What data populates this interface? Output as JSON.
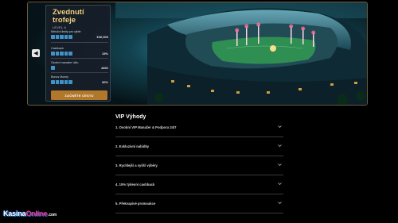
{
  "panel": {
    "title_line1": "Zvednutí",
    "title_line2": "trofeje",
    "level": "LEVEL 6",
    "stats": [
      {
        "label": "Měsíční limity pro výběr",
        "value": "€40,000",
        "filled": 5
      },
      {
        "label": "Cashback",
        "value": "15%",
        "filled": 5
      },
      {
        "label": "Osobní manažer účtu",
        "value": "ANO",
        "filled": 1
      },
      {
        "label": "Bonus Money",
        "value": "30%",
        "filled": 5
      }
    ],
    "cta_label": "ZAČNĚTE CESTU"
  },
  "vip": {
    "title": "VIP Výhody",
    "items": [
      {
        "label": "1. Osobní VIP Manažer & Podpora 24/7"
      },
      {
        "label": "2. Exkluzivní nabídky"
      },
      {
        "label": "3. Rychlejší a vyšší výběry"
      },
      {
        "label": "4. 15% týdenní cashback"
      },
      {
        "label": "5. Překvapivé promoakce"
      }
    ]
  },
  "logo": {
    "part1": "Kasina",
    "part2": "Online",
    "suffix": ".com"
  },
  "colors": {
    "gold": "#f2cf7a",
    "cta": "#b1782c",
    "box": "#3f93c6",
    "border": "#6e5a3a"
  },
  "icons": {
    "prev": "chevron-left-icon",
    "expand": "chevron-down-icon"
  }
}
